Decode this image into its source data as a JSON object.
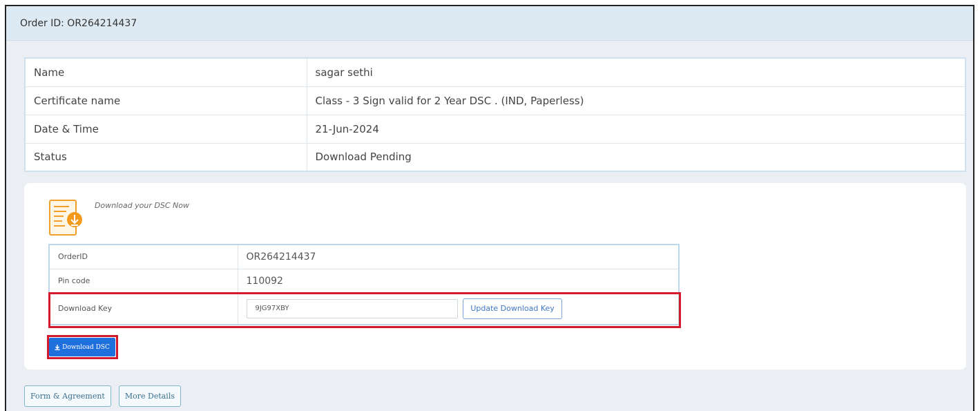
{
  "order_header": {
    "title": "Order ID: OR264214437"
  },
  "info_table": {
    "rows": [
      {
        "label": "Name",
        "value": "sagar sethi"
      },
      {
        "label": "Certificate name",
        "value": "Class - 3 Sign valid for 2 Year DSC . (IND, Paperless)"
      },
      {
        "label": "Date & Time",
        "value": "21-Jun-2024"
      },
      {
        "label": "Status",
        "value": "Download Pending"
      }
    ]
  },
  "download_card": {
    "caption": "Download your DSC Now",
    "icon": "document-download-icon",
    "order_id": {
      "label": "OrderID",
      "value": "OR264214437"
    },
    "pin_code": {
      "label": "Pin code",
      "value": "110092"
    },
    "download_key": {
      "label": "Download Key",
      "value": "9JG97XBY",
      "update_label": "Update Download Key"
    },
    "download_button": {
      "label": "Download DSC",
      "icon": "download-arrow-icon"
    }
  },
  "footer_buttons": {
    "form_agreement": "Form & Agreement",
    "more_details": "More Details"
  },
  "colors": {
    "header_bg": "#dde9f3",
    "status_pending": "#c9455a",
    "primary_button": "#1f6fdc",
    "highlight": "#d21a2c",
    "icon_orange": "#f0a02a"
  }
}
